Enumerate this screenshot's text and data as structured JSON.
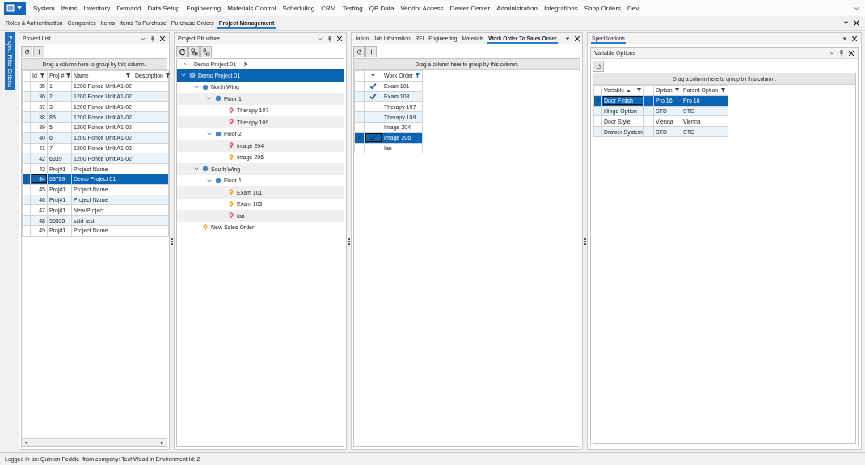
{
  "menu": {
    "items": [
      "System",
      "Items",
      "Inventory",
      "Demand",
      "Data Setup",
      "Engineering",
      "Materials Control",
      "Scheduling",
      "CRM",
      "Testing",
      "QB Data",
      "Vendor Access",
      "Dealer Center",
      "Administration",
      "Integrations",
      "Shop Orders",
      "Dev"
    ]
  },
  "module_tabs": [
    {
      "label": "Roles & Authentication",
      "selected": false
    },
    {
      "label": "Companies",
      "selected": false
    },
    {
      "label": "Items",
      "selected": false
    },
    {
      "label": "Items To Purchase",
      "selected": false
    },
    {
      "label": "Purchase Orders",
      "selected": false
    },
    {
      "label": "Project Management",
      "selected": true
    }
  ],
  "side_tab": {
    "label": "Project Filter Criteria"
  },
  "project_list": {
    "title": "Project List",
    "group_hint": "Drag a column here to group by this column.",
    "columns": [
      {
        "label": "Id",
        "kind": "text",
        "filter_active": false
      },
      {
        "label": "Proj #",
        "kind": "text",
        "filter_active": false
      },
      {
        "label": "Name",
        "kind": "text",
        "filter_active": false
      },
      {
        "label": "Description",
        "kind": "text",
        "filter_active": false
      }
    ],
    "rows": [
      {
        "cells": [
          "35",
          "1",
          "1200 Ponce Unit A1-02"
        ],
        "selected": false
      },
      {
        "cells": [
          "36",
          "2",
          "1200 Ponce Unit A1-02"
        ],
        "selected": false
      },
      {
        "cells": [
          "37",
          "3",
          "1200 Ponce Unit A1-02"
        ],
        "selected": false
      },
      {
        "cells": [
          "38",
          "85",
          "1200 Ponce Unit A1-02"
        ],
        "selected": false
      },
      {
        "cells": [
          "39",
          "5",
          "1200 Ponce Unit A1-02"
        ],
        "selected": false
      },
      {
        "cells": [
          "40",
          "6",
          "1200 Ponce Unit A1-02"
        ],
        "selected": false
      },
      {
        "cells": [
          "41",
          "7",
          "1200 Ponce Unit A1-02"
        ],
        "selected": false
      },
      {
        "cells": [
          "42",
          "6339",
          "1200 Ponce Unit A1-02"
        ],
        "selected": false
      },
      {
        "cells": [
          "43",
          "Proj#1",
          "Project Name"
        ],
        "selected": false
      },
      {
        "cells": [
          "44",
          "63789",
          "Demo Project 01"
        ],
        "selected": true
      },
      {
        "cells": [
          "45",
          "Proj#1",
          "Project Name"
        ],
        "selected": false
      },
      {
        "cells": [
          "46",
          "Proj#1",
          "Project Name"
        ],
        "selected": false
      },
      {
        "cells": [
          "47",
          "Proj#1",
          "New Project"
        ],
        "selected": false
      },
      {
        "cells": [
          "48",
          "55555",
          "scld test"
        ],
        "selected": false
      },
      {
        "cells": [
          "49",
          "Proj#1",
          "Project Name"
        ],
        "selected": false
      }
    ]
  },
  "project_structure": {
    "title": "Project Structure",
    "breadcrumb": "Demo Project 01",
    "tree": [
      {
        "label": "Demo Project 01",
        "kind": "node",
        "expanded": true,
        "selected": true,
        "children": [
          {
            "label": "North Wing",
            "kind": "node",
            "expanded": true,
            "selected": false,
            "children": [
              {
                "label": "Floor 1",
                "kind": "node",
                "expanded": true,
                "selected": false,
                "children": [
                  {
                    "label": "Therapy 107",
                    "kind": "pin",
                    "color": "#e8646e",
                    "selected": false
                  },
                  {
                    "label": "Therapy 109",
                    "kind": "pin",
                    "color": "#e8646e",
                    "selected": false
                  }
                ]
              },
              {
                "label": "Floor 2",
                "kind": "node",
                "expanded": true,
                "selected": false,
                "children": [
                  {
                    "label": "Image 204",
                    "kind": "pin",
                    "color": "#e8646e",
                    "selected": false
                  },
                  {
                    "label": "Image 206",
                    "kind": "pin",
                    "color": "#f5b12e",
                    "selected": false
                  }
                ]
              }
            ]
          },
          {
            "label": "South Wing",
            "kind": "node",
            "expanded": true,
            "selected": false,
            "children": [
              {
                "label": "Floor 1",
                "kind": "node",
                "expanded": true,
                "selected": false,
                "children": [
                  {
                    "label": "Exam 101",
                    "kind": "pin",
                    "color": "#f5b12e",
                    "selected": false
                  },
                  {
                    "label": "Exam 103",
                    "kind": "pin",
                    "color": "#f5b12e",
                    "selected": false
                  },
                  {
                    "label": "Ian",
                    "kind": "pin",
                    "color": "#e8646e",
                    "selected": false
                  }
                ]
              }
            ]
          },
          {
            "label": "New Sales Order",
            "kind": "pin",
            "color": "#f5b12e",
            "selected": false
          }
        ]
      }
    ]
  },
  "work_orders": {
    "tabs": [
      {
        "label": "tation",
        "selected": false
      },
      {
        "label": "Job Information",
        "selected": false
      },
      {
        "label": "RFI",
        "selected": false
      },
      {
        "label": "Engineering",
        "selected": false
      },
      {
        "label": "Materials",
        "selected": false
      },
      {
        "label": "Work Order To Sales Order",
        "selected": true
      }
    ],
    "group_hint": "Drag a column here to group by this column.",
    "columns": [
      {
        "kind": "check"
      },
      {
        "label": "Work Order",
        "kind": "text",
        "filter_active": true
      }
    ],
    "rows": [
      {
        "checked": true,
        "cells": [
          "Exam 101"
        ],
        "selected": false
      },
      {
        "checked": true,
        "cells": [
          "Exam 103"
        ],
        "selected": false
      },
      {
        "checked": false,
        "cells": [
          "Therapy 107"
        ],
        "selected": false
      },
      {
        "checked": false,
        "cells": [
          "Therapy 109"
        ],
        "selected": false
      },
      {
        "checked": false,
        "cells": [
          "Image 204"
        ],
        "selected": false
      },
      {
        "checked": true,
        "cells": [
          "Image 206"
        ],
        "selected": true
      },
      {
        "checked": false,
        "cells": [
          "Ian"
        ],
        "selected": false
      }
    ]
  },
  "specifications": {
    "tabs": [
      {
        "label": "Specifications",
        "selected": true
      }
    ],
    "variable_options": {
      "title": "Variable Options",
      "group_hint": "Drag a column here to group by this column.",
      "columns": [
        {
          "label": "Variable",
          "kind": "text",
          "filter_active": false,
          "sorted": true
        },
        {
          "kind": "spacer"
        },
        {
          "label": "Option",
          "kind": "text",
          "filter_active": false,
          "sorted": false
        },
        {
          "label": "Parent Option",
          "kind": "text",
          "filter_active": false,
          "sorted": false
        }
      ],
      "rows": [
        {
          "cells": [
            "Door Finish",
            "",
            "Pro 16",
            "Pro 16"
          ],
          "selected": true
        },
        {
          "cells": [
            "Hinge Option",
            "",
            "STD",
            "STD"
          ],
          "selected": false
        },
        {
          "cells": [
            "Door Style",
            "",
            "Vienna",
            "Vienna"
          ],
          "selected": false
        },
        {
          "cells": [
            "Drawer System",
            "",
            "STD",
            "STD"
          ],
          "selected": false
        }
      ]
    }
  },
  "status_bar": {
    "text": "Logged in as: Quinten Peddie  from company: TechWood in Environment Id: 2"
  }
}
